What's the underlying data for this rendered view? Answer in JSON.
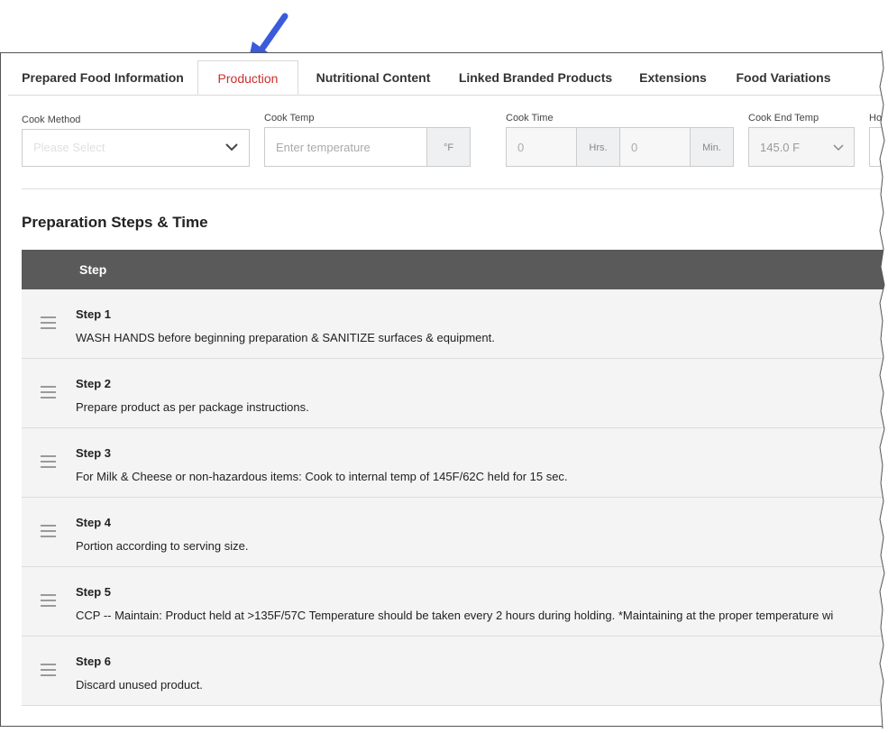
{
  "tabs": [
    {
      "label": "Prepared Food Information",
      "active": false
    },
    {
      "label": "Production",
      "active": true
    },
    {
      "label": "Nutritional Content",
      "active": false
    },
    {
      "label": "Linked Branded Products",
      "active": false
    },
    {
      "label": "Extensions",
      "active": false
    },
    {
      "label": "Food Variations",
      "active": false
    }
  ],
  "fields": {
    "cook_method": {
      "label": "Cook Method",
      "placeholder": "Please Select"
    },
    "cook_temp": {
      "label": "Cook Temp",
      "placeholder": "Enter temperature",
      "unit": "°F"
    },
    "cook_time": {
      "label": "Cook Time",
      "hours_value": "0",
      "hours_unit": "Hrs.",
      "minutes_value": "0",
      "minutes_unit": "Min."
    },
    "cook_end_temp": {
      "label": "Cook End Temp",
      "value": "145.0 F"
    },
    "hold_label_partial": "Hol"
  },
  "section_title": "Preparation Steps & Time",
  "table_header": "Step",
  "steps": [
    {
      "label": "Step 1",
      "text": "WASH HANDS before beginning preparation & SANITIZE surfaces & equipment."
    },
    {
      "label": "Step 2",
      "text": "Prepare product as per package instructions."
    },
    {
      "label": "Step 3",
      "text": "For Milk & Cheese or non-hazardous items: Cook to internal temp of 145F/62C held for 15 sec."
    },
    {
      "label": "Step 4",
      "text": "Portion according to serving size."
    },
    {
      "label": "Step 5",
      "text": "CCP -- Maintain: Product held at >135F/57C Temperature should be taken every 2 hours during holding. *Maintaining at the proper temperature wi"
    },
    {
      "label": "Step 6",
      "text": "Discard unused product."
    }
  ],
  "colors": {
    "active_tab": "#c9302c",
    "table_header_bg": "#5a5a5a",
    "arrow": "#3b5bdb"
  }
}
